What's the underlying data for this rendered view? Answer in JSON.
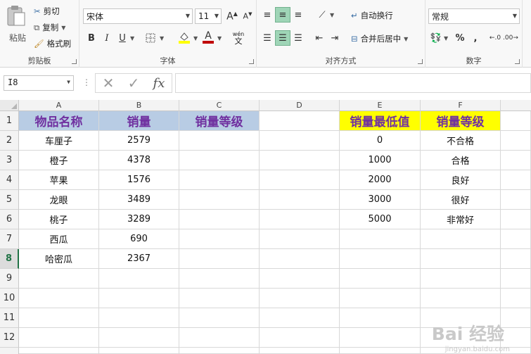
{
  "ribbon": {
    "clipboard": {
      "label": "剪贴板",
      "paste": "粘贴",
      "cut": "剪切",
      "copy": "复制",
      "format_painter": "格式刷"
    },
    "font": {
      "label": "字体",
      "name": "宋体",
      "size": "11",
      "bold": "B",
      "italic": "I",
      "underline": "U",
      "wen": "wén",
      "wen_sub": "文"
    },
    "alignment": {
      "label": "对齐方式",
      "wrap_text": "自动换行",
      "merge_center": "合并后居中"
    },
    "number": {
      "label": "数字",
      "format": "常规",
      "percent": "%",
      "comma": ","
    }
  },
  "formula_bar": {
    "name_box": "I8",
    "fx": "fx",
    "value": ""
  },
  "columns": [
    "A",
    "B",
    "C",
    "D",
    "E",
    "F"
  ],
  "rows": [
    "1",
    "2",
    "3",
    "4",
    "5",
    "6",
    "7",
    "8",
    "9",
    "10",
    "11",
    "12"
  ],
  "table": {
    "headers": {
      "name": "物品名称",
      "sales": "销量",
      "grade": "销量等级",
      "min_sales": "销量最低值",
      "grade_level": "销量等级"
    },
    "items": [
      {
        "name": "车厘子",
        "sales": "2579"
      },
      {
        "name": "橙子",
        "sales": "4378"
      },
      {
        "name": "苹果",
        "sales": "1576"
      },
      {
        "name": "龙眼",
        "sales": "3489"
      },
      {
        "name": "桃子",
        "sales": "3289"
      },
      {
        "name": "西瓜",
        "sales": "690"
      },
      {
        "name": "哈密瓜",
        "sales": "2367"
      }
    ],
    "lookup": [
      {
        "min": "0",
        "grade": "不合格"
      },
      {
        "min": "1000",
        "grade": "合格"
      },
      {
        "min": "2000",
        "grade": "良好"
      },
      {
        "min": "3000",
        "grade": "很好"
      },
      {
        "min": "5000",
        "grade": "非常好"
      }
    ]
  },
  "watermark": {
    "text": "Bai 经验",
    "url": "jingyan.baidu.com"
  },
  "colors": {
    "header_blue": "#b8cce4",
    "header_yellow": "#ffff00",
    "header_text": "#7030a0",
    "excel_green": "#217346"
  }
}
